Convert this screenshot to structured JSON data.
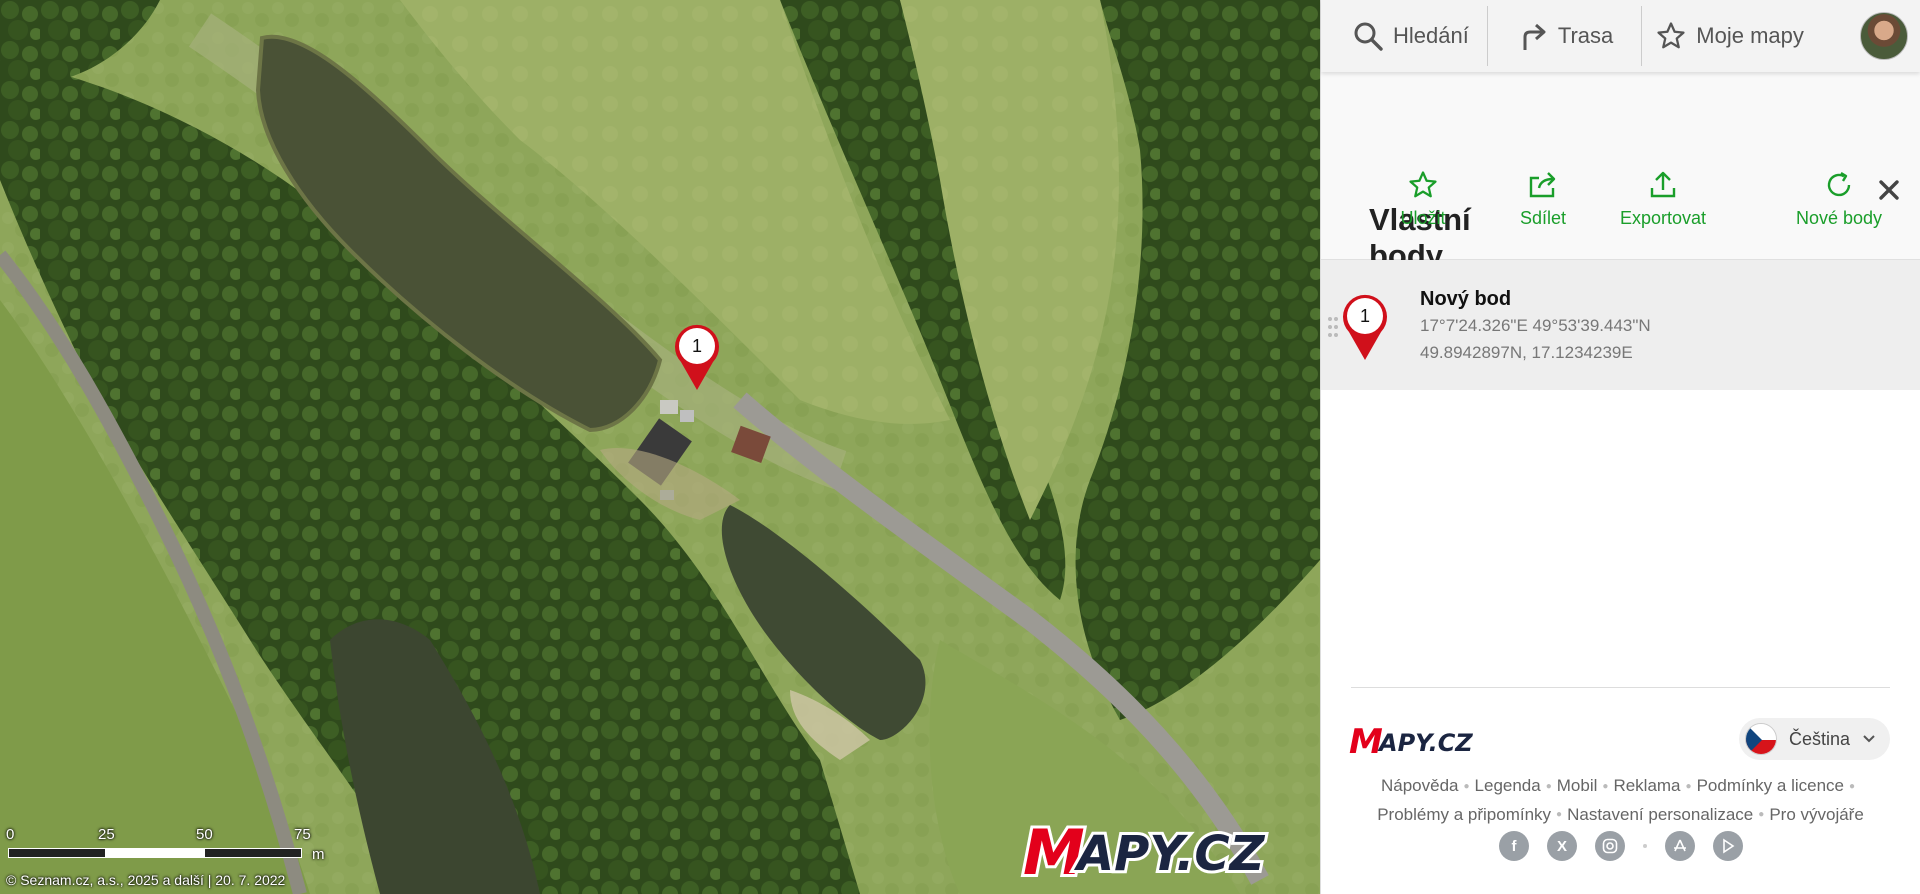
{
  "topbar": {
    "search_label": "Hledání",
    "route_label": "Trasa",
    "mymaps_label": "Moje mapy",
    "icons": [
      "search-icon",
      "route-arrow-icon",
      "star-icon"
    ]
  },
  "panel": {
    "title": "Vlastní body",
    "actions": [
      {
        "label": "Uložit",
        "icon": "star-icon"
      },
      {
        "label": "Sdílet",
        "icon": "share-icon"
      },
      {
        "label": "Exportovat",
        "icon": "upload-icon"
      },
      {
        "label": "Nové body",
        "icon": "refresh-icon"
      }
    ],
    "points": [
      {
        "number": "1",
        "name": "Nový bod",
        "dms": "17°7'24.326\"E 49°53'39.443\"N",
        "decimal": "49.8942897N, 17.1234239E"
      }
    ]
  },
  "footer": {
    "language": "Čeština",
    "links": [
      "Nápověda",
      "Legenda",
      "Mobil",
      "Reklama",
      "Podmínky a licence",
      "Problémy a připomínky",
      "Nastavení personalizace",
      "Pro vývojáře"
    ],
    "social": [
      "facebook-icon",
      "x-icon",
      "instagram-icon",
      "app-store-icon",
      "google-play-icon"
    ]
  },
  "map": {
    "marker_number": "1",
    "scale_labels": [
      "0",
      "25",
      "50",
      "75"
    ],
    "scale_unit": "m",
    "copyright": "© Seznam.cz, a.s., 2025 a další | 20. 7. 2022"
  },
  "colors": {
    "accent_green": "#1a9e2a",
    "pin_red": "#d0101b",
    "logo_red": "#e3001b",
    "logo_navy": "#1b2541"
  }
}
